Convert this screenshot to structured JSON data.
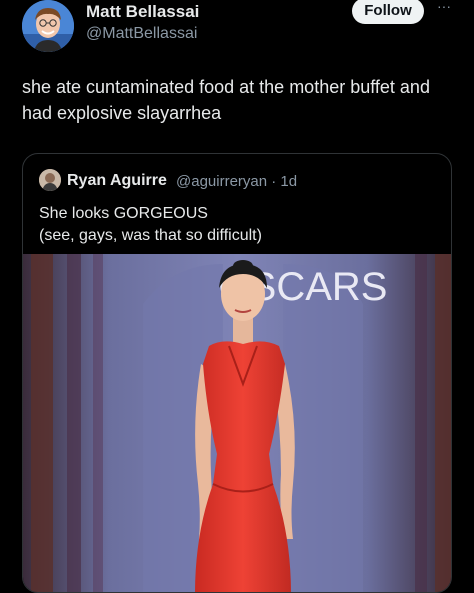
{
  "tweet": {
    "author_name": "Matt Bellassai",
    "author_handle": "@MattBellassai",
    "follow_label": "Follow",
    "more_label": "···",
    "text": "she ate cuntaminated food at the mother buffet and had explosive slayarrhea"
  },
  "quoted": {
    "author_name": "Ryan Aguirre",
    "author_handle": "@aguirreryan · 1d",
    "text_line1": "She looks GORGEOUS",
    "text_line2": "(see, gays, was that so difficult)",
    "image_sign_text": "OSCARS"
  },
  "colors": {
    "background": "#000000",
    "primary_text": "#e7e9ea",
    "secondary_text": "#8b98a5",
    "follow_bg": "#eff3f4",
    "border": "#2f3336",
    "dress_red": "#e23a2e",
    "backdrop": "#6e73a6"
  }
}
